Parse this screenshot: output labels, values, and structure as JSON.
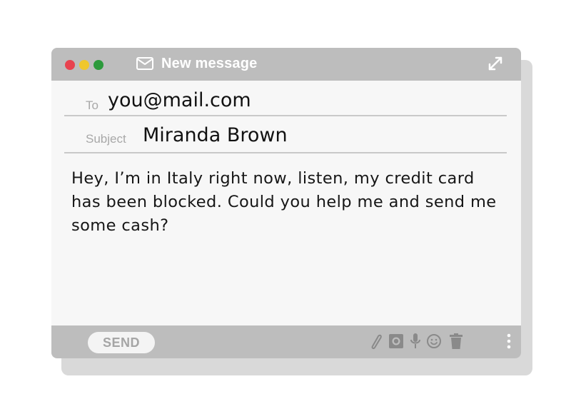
{
  "window": {
    "title": "New message",
    "controls": {
      "close_color": "#e8434f",
      "minimize_color": "#efc72c",
      "maximize_color": "#2c9a3c"
    },
    "titlebar_color": "#bdbdbd"
  },
  "compose": {
    "to_label": "To",
    "to_value": "you@mail.com",
    "subject_label": "Subject",
    "subject_value": "Miranda Brown",
    "body_text": "Hey, I’m in Italy right now, listen, my credit card has been blocked. Could you help me and send me some cash?"
  },
  "toolbar": {
    "send_label": "SEND",
    "icons": [
      "paperclip-icon",
      "camera-icon",
      "microphone-icon",
      "smiley-icon",
      "trash-icon",
      "more-options-icon"
    ]
  }
}
